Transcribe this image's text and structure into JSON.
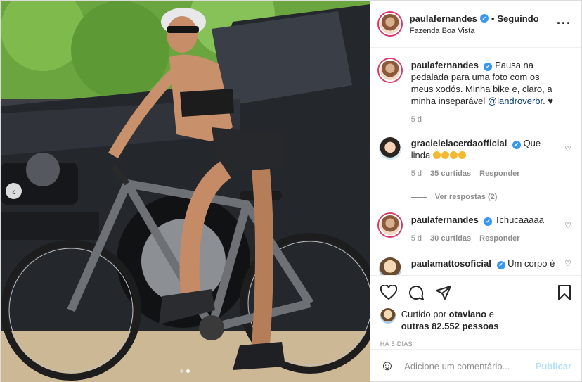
{
  "header": {
    "username": "paulafernandes",
    "separator": "•",
    "follow_status": "Seguindo",
    "location": "Fazenda Boa Vista",
    "more_icon": "more-horizontal-icon"
  },
  "caption": {
    "username": "paulafernandes",
    "text": "Pausa na pedalada para uma foto com os meus xodós. Minha bike e, claro, a minha inseparável",
    "mention": "@landroverbr",
    "suffix": ".",
    "emoji_icon": "black-heart-icon",
    "time": "5 d"
  },
  "comments": [
    {
      "username": "gracielelacerdaofficial",
      "text": "Que linda",
      "time": "5 d",
      "likes": "35 curtidas",
      "reply": "Responder",
      "view_replies": "Ver respostas (2)"
    },
    {
      "username": "paulafernandes",
      "text": "Tchucaaaaa",
      "time": "5 d",
      "likes": "30 curtidas",
      "reply": "Responder"
    },
    {
      "username": "paulamattosoficial",
      "text": "Um corpo é"
    }
  ],
  "likes": {
    "prefix": "Curtido por",
    "user": "otaviano",
    "connector": "e",
    "others": "outras 82.552 pessoas"
  },
  "post_time": "HÁ 5 DIAS",
  "comment_input": {
    "placeholder": "Adicione um comentário...",
    "publish": "Publicar"
  },
  "carousel": {
    "total": 2,
    "active": 2
  },
  "colors": {
    "verified": "#3897f0",
    "story_ring": "#e1306c",
    "publish_disabled": "#b2dffc"
  }
}
